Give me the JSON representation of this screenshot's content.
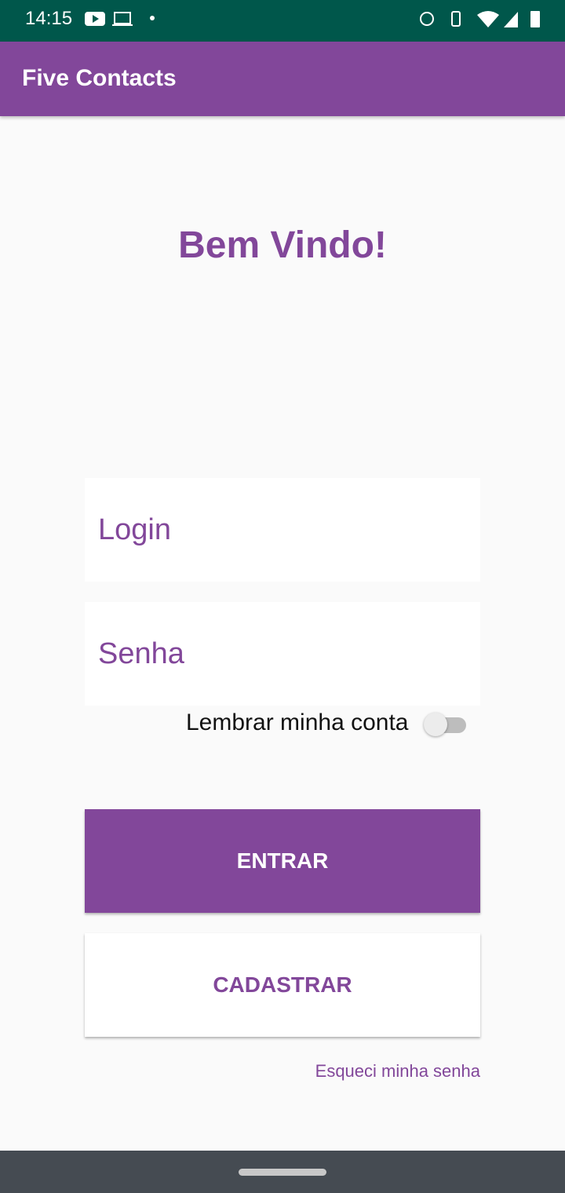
{
  "status_bar": {
    "time": "14:15"
  },
  "app_bar": {
    "title": "Five Contacts"
  },
  "main": {
    "welcome": "Bem Vindo!",
    "login_placeholder": "Login",
    "password_placeholder": "Senha",
    "remember_label": "Lembrar minha conta",
    "remember_on": false,
    "enter_label": "ENTRAR",
    "register_label": "CADASTRAR",
    "forgot_label": "Esqueci minha senha"
  },
  "colors": {
    "primary": "#82479a",
    "status": "#00574b"
  }
}
